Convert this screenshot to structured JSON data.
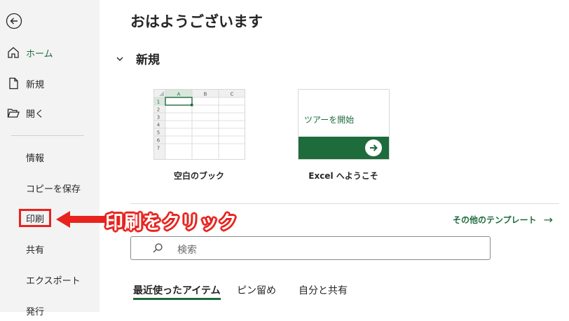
{
  "sidebar": {
    "home_label": "ホーム",
    "new_label": "新規",
    "open_label": "開く",
    "info_label": "情報",
    "save_copy_label": "コピーを保存",
    "print_label": "印刷",
    "share_label": "共有",
    "export_label": "エクスポート",
    "publish_label": "発行"
  },
  "main": {
    "greeting": "おはようございます",
    "new_section_title": "新規",
    "templates": [
      {
        "label": "空白のブック"
      },
      {
        "label": "Excel へようこそ",
        "tile_text": "ツアーを開始"
      }
    ],
    "blank_grid": {
      "columns": [
        "A",
        "B",
        "C"
      ],
      "rows": [
        "1",
        "2",
        "3",
        "4",
        "5",
        "6",
        "7"
      ]
    },
    "more_templates_label": "その他のテンプレート",
    "search_placeholder": "検索",
    "tabs": [
      "最近使ったアイテム",
      "ピン留め",
      "自分と共有"
    ]
  },
  "annotation": {
    "text": "印刷をクリック"
  },
  "colors": {
    "accent": "#1e6b3c",
    "annotation_red": "#e8231e",
    "sidebar_bg": "#f3f3f3"
  }
}
